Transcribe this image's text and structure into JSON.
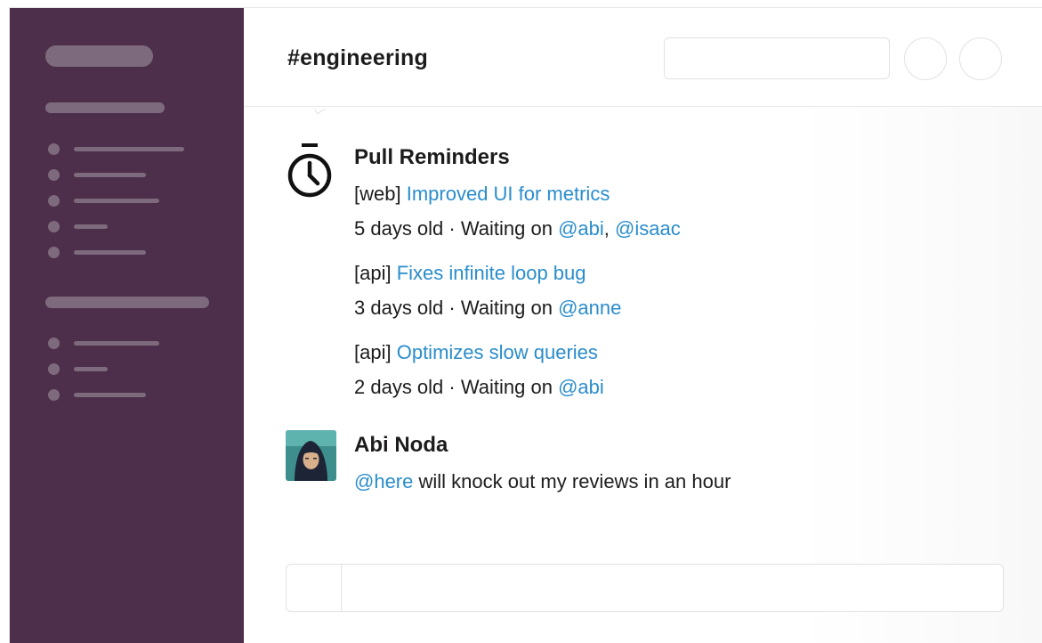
{
  "header": {
    "channel": "#engineering"
  },
  "messages": {
    "bot": {
      "sender": "Pull Reminders",
      "icon": "stopwatch-icon",
      "items": [
        {
          "repo": "[web]",
          "title": "Improved UI for metrics",
          "age": "5 days old · Waiting on",
          "reviewers": [
            "@abi",
            "@isaac"
          ],
          "separator": ", "
        },
        {
          "repo": "[api]",
          "title": "Fixes infinite loop bug",
          "age": "3 days old · Waiting on",
          "reviewers": [
            "@anne"
          ]
        },
        {
          "repo": "[api]",
          "title": "Optimizes slow queries",
          "age": "2 days old · Waiting on",
          "reviewers": [
            "@abi"
          ]
        }
      ]
    },
    "user": {
      "sender": "Abi Noda",
      "mention": "@here",
      "text": " will knock out my reviews in an hour"
    }
  },
  "colors": {
    "sidebar": "#4d2f4b",
    "sidebar_placeholder": "#7e6a7d",
    "link": "#2a8dcb",
    "text": "#1d1c1d"
  }
}
